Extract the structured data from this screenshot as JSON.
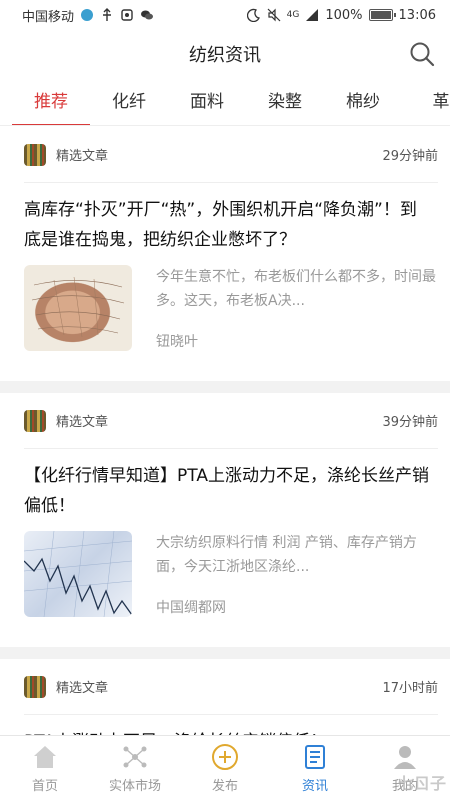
{
  "status_bar": {
    "carrier": "中国移动",
    "icons": [
      "wifi-icon",
      "usb-icon",
      "mute-icon",
      "wechat-icon"
    ],
    "network": "4G",
    "battery": "100%",
    "battery_level": 1.0,
    "clock": "13:06"
  },
  "header": {
    "title": "纺织资讯"
  },
  "tabs": [
    {
      "label": "推荐"
    },
    {
      "label": "化纤"
    },
    {
      "label": "面料"
    },
    {
      "label": "染整"
    },
    {
      "label": "棉纱"
    },
    {
      "label": "革"
    }
  ],
  "articles": [
    {
      "category": "精选文章",
      "time": "29分钟前",
      "title": "高库存“扑灭”开厂“热”，外围织机开启“降负潮”！到底是谁在捣鬼，把纺织企业憋坏了？",
      "summary": "今年生意不忙，布老板们什么都不多，时间最多。这天，布老板A决...",
      "source": "钮晓叶"
    },
    {
      "category": "精选文章",
      "time": "39分钟前",
      "title": "【化纤行情早知道】PTA上涨动力不足，涤纶长丝产销偏低！",
      "summary": "大宗纺织原料行情 利润 产销、库存产销方面，今天江浙地区涤纶...",
      "source": "中国绸都网"
    },
    {
      "category": "精选文章",
      "time": "17小时前",
      "title": "PTA上涨动力不足，涤纶长丝产销偏低！",
      "summary": "",
      "source": ""
    }
  ],
  "bottom_nav": [
    {
      "label": "首页",
      "icon": "home-icon"
    },
    {
      "label": "实体市场",
      "icon": "network-icon"
    },
    {
      "label": "发布",
      "icon": "plus-circle-icon"
    },
    {
      "label": "资讯",
      "icon": "news-icon",
      "active": true
    },
    {
      "label": "我的",
      "icon": "user-icon"
    }
  ],
  "watermark": "七ㄖ子",
  "colors": {
    "accent_red": "#d93a3a",
    "accent_blue": "#2f80d6",
    "publish_gold": "#e0a82e"
  }
}
